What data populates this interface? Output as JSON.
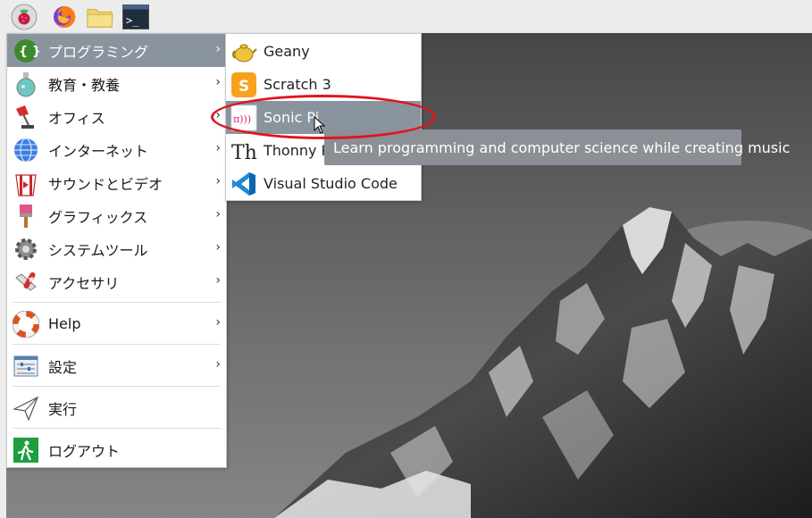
{
  "taskbar": {
    "icons": [
      "raspberry-menu-icon",
      "firefox-icon",
      "file-manager-icon",
      "terminal-icon"
    ],
    "terminal_glyph": ">_"
  },
  "main_menu": {
    "items": [
      {
        "label": "プログラミング",
        "icon": "programming-braces-icon",
        "has_submenu": true
      },
      {
        "label": "教育・教養",
        "icon": "education-flask-icon",
        "has_submenu": true
      },
      {
        "label": "オフィス",
        "icon": "office-lamp-icon",
        "has_submenu": true
      },
      {
        "label": "インターネット",
        "icon": "internet-globe-icon",
        "has_submenu": true
      },
      {
        "label": "サウンドとビデオ",
        "icon": "sound-video-popcorn-icon",
        "has_submenu": true
      },
      {
        "label": "グラフィックス",
        "icon": "graphics-brush-icon",
        "has_submenu": true
      },
      {
        "label": "システムツール",
        "icon": "system-tools-gear-icon",
        "has_submenu": true
      },
      {
        "label": "アクセサリ",
        "icon": "accessories-knife-icon",
        "has_submenu": true
      },
      {
        "label": "Help",
        "icon": "help-lifebuoy-icon",
        "has_submenu": true
      },
      {
        "label": "設定",
        "icon": "settings-sliders-icon",
        "has_submenu": true
      },
      {
        "label": "実行",
        "icon": "run-paperplane-icon",
        "has_submenu": false
      },
      {
        "label": "ログアウト",
        "icon": "logout-exit-icon",
        "has_submenu": false
      }
    ],
    "chevron": "›"
  },
  "sub_menu": {
    "items": [
      {
        "label": "Geany",
        "icon": "geany-teapot-icon"
      },
      {
        "label": "Scratch 3",
        "icon": "scratch-icon"
      },
      {
        "label": "Sonic Pi",
        "icon": "sonic-pi-icon"
      },
      {
        "label": "Thonny Py",
        "icon": "thonny-icon"
      },
      {
        "label": "Visual Studio Code",
        "icon": "vscode-icon"
      }
    ],
    "sonic_pi_glyph": "π)))",
    "thonny_glyph": "Th"
  },
  "tooltip": {
    "text": "Learn programming and computer science while creating music"
  },
  "colors": {
    "selected_bg": "#8a949e",
    "tooltip_bg": "#8a9096",
    "annotation": "#e0141e"
  }
}
